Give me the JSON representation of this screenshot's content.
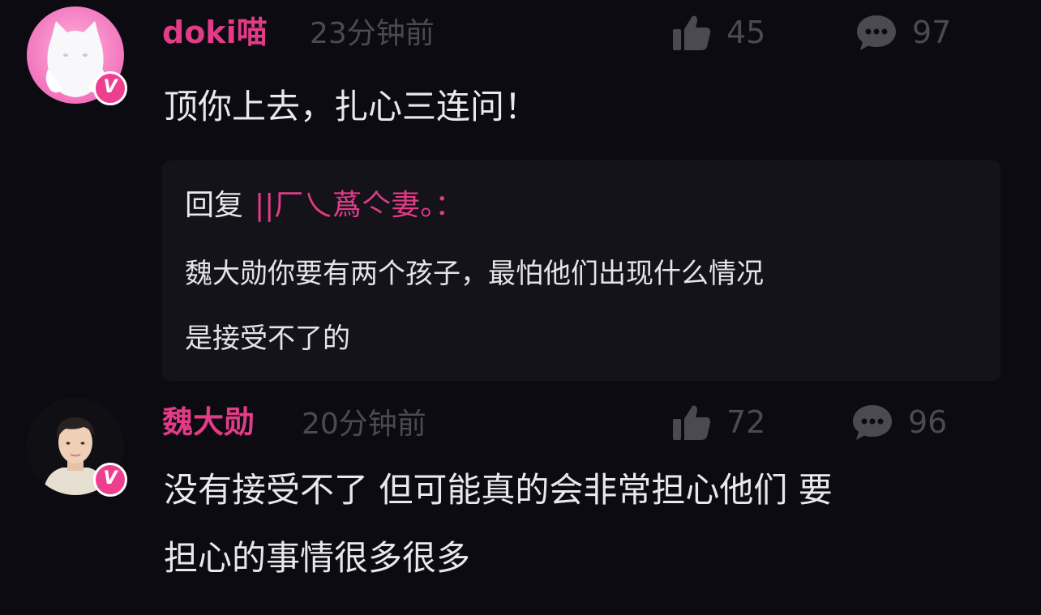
{
  "comments": [
    {
      "username": "doki喵",
      "time": "23分钟前",
      "likes": "45",
      "replies": "97",
      "verified_badge": "V",
      "avatar": "white-cat-avatar",
      "text_lines": [
        "顶你上去，扎心三连问！"
      ],
      "quoted": {
        "prefix": "回复",
        "target": "||厂乀蔿亽妻。：",
        "text_lines": [
          "魏大勋你要有两个孩子，最怕他们出现什么情况",
          "是接受不了的"
        ]
      }
    },
    {
      "username": "魏大勋",
      "time": "20分钟前",
      "likes": "72",
      "replies": "96",
      "verified_badge": "V",
      "avatar": "man-portrait-avatar",
      "text_lines": [
        "没有接受不了 但可能真的会非常担心他们 要",
        "担心的事情很多很多"
      ]
    }
  ],
  "colors": {
    "background": "#0c0b11",
    "username": "#e23b88",
    "meta": "#4b4a52",
    "text": "#e9e9ec",
    "quote_background": "#141319",
    "badge": "#ee3f8e"
  },
  "icons": [
    "thumbs-up-icon",
    "comment-bubble-icon",
    "verified-v-icon"
  ]
}
